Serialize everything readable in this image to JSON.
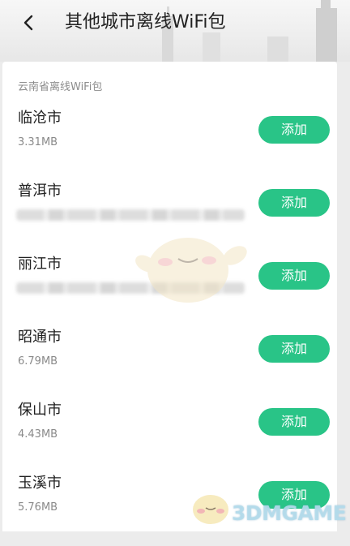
{
  "header": {
    "title": "其他城市离线WiFi包"
  },
  "section": {
    "title": "云南省离线WiFi包"
  },
  "button_label": "添加",
  "cities": [
    {
      "name": "临沧市",
      "size": "3.31MB"
    },
    {
      "name": "普洱市",
      "size": ""
    },
    {
      "name": "丽江市",
      "size": ""
    },
    {
      "name": "昭通市",
      "size": "6.79MB"
    },
    {
      "name": "保山市",
      "size": "4.43MB"
    },
    {
      "name": "玉溪市",
      "size": "5.76MB"
    }
  ],
  "watermark": {
    "text": "3DMGAME"
  },
  "colors": {
    "accent": "#29c487",
    "background": "#ececec",
    "card": "#ffffff"
  }
}
